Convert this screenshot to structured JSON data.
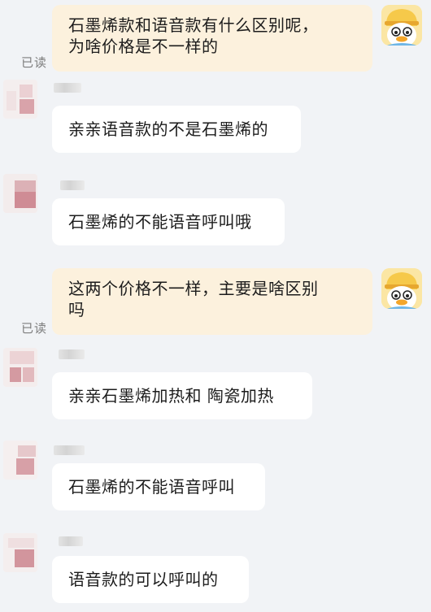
{
  "conversation": {
    "messages": [
      {
        "side": "out",
        "text": "石墨烯款和语音款有什么区别呢，\n为啥价格是不一样的",
        "status": "已读"
      },
      {
        "side": "in",
        "text": "亲亲语音款的不是石墨烯的"
      },
      {
        "side": "in",
        "text": "石墨烯的不能语音呼叫哦"
      },
      {
        "side": "out",
        "text": "这两个价格不一样，主要是啥区别\n吗",
        "status": "已读"
      },
      {
        "side": "in",
        "text": "亲亲石墨烯加热和 陶瓷加热"
      },
      {
        "side": "in",
        "text": "石墨烯的不能语音呼叫"
      },
      {
        "side": "in",
        "text": "语音款的可以呼叫的"
      }
    ]
  },
  "colors": {
    "background": "#f1f3f6",
    "outgoing_bubble": "#fcf1dd",
    "incoming_bubble": "#ffffff",
    "read_status": "#7d7d7d"
  },
  "icons": {
    "user_avatar": "yellow-duck-avatar-icon",
    "agent_avatar": "blurred-shop-avatar-icon"
  }
}
